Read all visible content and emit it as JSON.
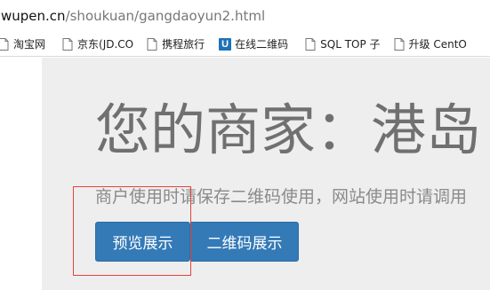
{
  "address_bar": {
    "url_host": "wupen.cn",
    "url_path": "/shoukuan/gangdaoyun2.html"
  },
  "bookmarks": [
    {
      "label": "淘宝网",
      "icon": "document-icon"
    },
    {
      "label": "京东(JD.CO",
      "icon": "document-icon"
    },
    {
      "label": "携程旅行",
      "icon": "document-icon"
    },
    {
      "label": "在线二维码",
      "icon": "u-logo-icon"
    },
    {
      "label": "SQL TOP 子",
      "icon": "document-icon"
    },
    {
      "label": "升级 CentO",
      "icon": "document-icon"
    }
  ],
  "main": {
    "headline": "您的商家：港岛",
    "subtext": "商户使用时请保存二维码使用，网站使用时请调用",
    "buttons": {
      "preview": "预览展示",
      "qrcode": "二维码展示"
    },
    "u_logo_letter": "U"
  },
  "colors": {
    "button_primary": "#337ab7",
    "jumbotron_bg": "#eeeeee",
    "highlight_border": "#e0443b"
  }
}
